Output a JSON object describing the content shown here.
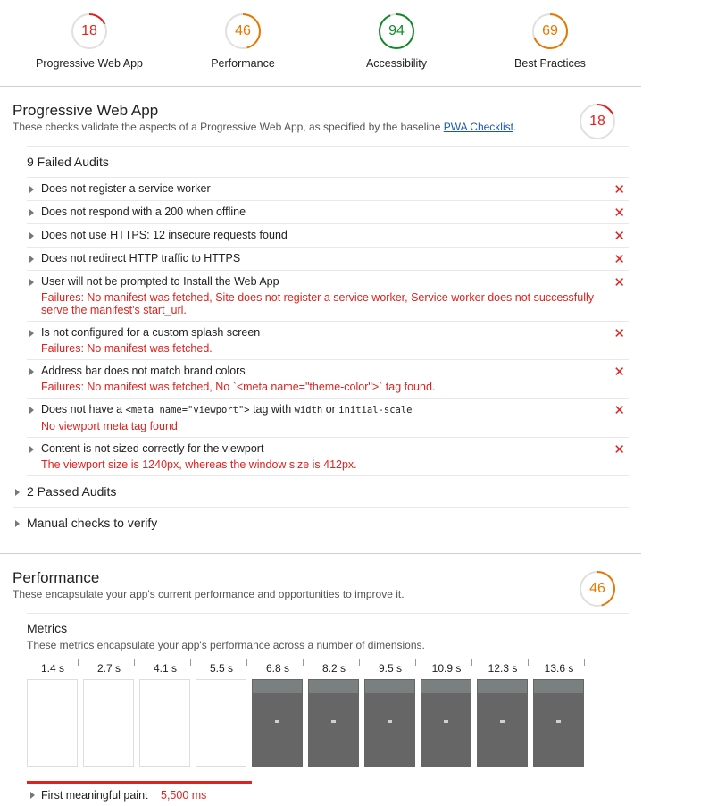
{
  "scores": [
    {
      "label": "Progressive Web App",
      "value": "18",
      "color": "#e0221e",
      "fraction": 0.18
    },
    {
      "label": "Performance",
      "value": "46",
      "color": "#e67700",
      "fraction": 0.46
    },
    {
      "label": "Accessibility",
      "value": "94",
      "color": "#118a26",
      "fraction": 0.94
    },
    {
      "label": "Best Practices",
      "value": "69",
      "color": "#e67700",
      "fraction": 0.69
    }
  ],
  "pwa": {
    "title": "Progressive Web App",
    "description": "These checks validate the aspects of a Progressive Web App, as specified by the baseline ",
    "link_text": "PWA Checklist",
    "description_end": ".",
    "score": "18",
    "failed_group_title": "9 Failed Audits",
    "audits": [
      {
        "title": "Does not register a service worker",
        "detail": ""
      },
      {
        "title": "Does not respond with a 200 when offline",
        "detail": ""
      },
      {
        "title": "Does not use HTTPS: 12 insecure requests found",
        "detail": ""
      },
      {
        "title": "Does not redirect HTTP traffic to HTTPS",
        "detail": ""
      },
      {
        "title": "User will not be prompted to Install the Web App",
        "detail": "Failures: No manifest was fetched, Site does not register a service worker, Service worker does not successfully serve the manifest's start_url."
      },
      {
        "title": "Is not configured for a custom splash screen",
        "detail": "Failures: No manifest was fetched."
      },
      {
        "title": "Address bar does not match brand colors",
        "detail": "Failures: No manifest was fetched, No `<meta name=\"theme-color\">` tag found."
      },
      {
        "title_pre": "Does not have a ",
        "title_code1": "<meta name=\"viewport\">",
        "title_mid": " tag with ",
        "title_code2": "width",
        "title_mid2": " or ",
        "title_code3": "initial-scale",
        "detail": "No viewport meta tag found"
      },
      {
        "title": "Content is not sized correctly for the viewport",
        "detail": "The viewport size is 1240px, whereas the window size is 412px."
      }
    ],
    "passed_group_title": "2 Passed Audits",
    "manual_group_title": "Manual checks to verify"
  },
  "performance": {
    "title": "Performance",
    "description": "These encapsulate your app's current performance and opportunities to improve it.",
    "score": "46",
    "metrics_title": "Metrics",
    "metrics_description": "These metrics encapsulate your app's performance across a number of dimensions.",
    "timeline_ticks": [
      "1.4 s",
      "2.7 s",
      "4.1 s",
      "5.5 s",
      "6.8 s",
      "8.2 s",
      "9.5 s",
      "10.9 s",
      "12.3 s",
      "13.6 s"
    ],
    "frames_painted": [
      false,
      false,
      false,
      false,
      true,
      true,
      true,
      true,
      true,
      true
    ],
    "metric_name": "First meaningful paint",
    "metric_value": "5,500 ms"
  },
  "icons": {
    "fail": "fail-x-icon",
    "expand": "triangle-right-icon"
  }
}
